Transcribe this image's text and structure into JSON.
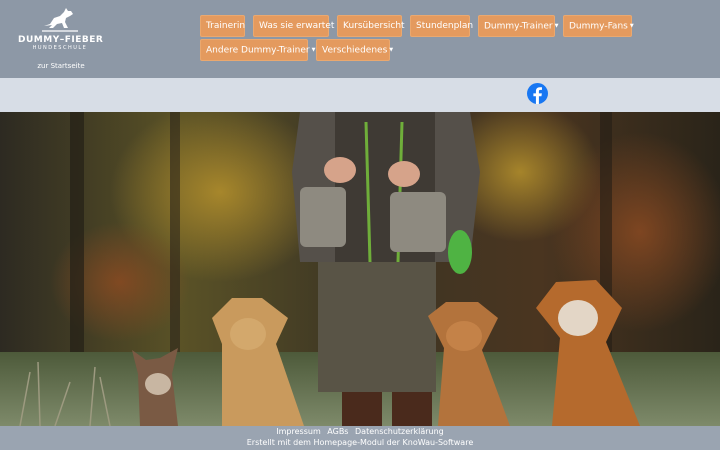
{
  "brand": {
    "name": "DUMMY–FIEBER",
    "tagline": "HUNDESCHULE",
    "home_link": "zur Startseite"
  },
  "nav": {
    "items": [
      {
        "label": "Trainerin",
        "dropdown": false
      },
      {
        "label": "Was sie erwartet",
        "dropdown": false
      },
      {
        "label": "Kursübersicht",
        "dropdown": false
      },
      {
        "label": "Stundenplan",
        "dropdown": false
      },
      {
        "label": "Dummy-Trainer",
        "dropdown": true
      },
      {
        "label": "Dummy-Fans",
        "dropdown": true
      },
      {
        "label": "Andere Dummy-Trainer",
        "dropdown": true
      },
      {
        "label": "Verschiedenes",
        "dropdown": true
      }
    ],
    "caret": "▼"
  },
  "social": {
    "icon": "facebook-icon",
    "color": "#1877f2"
  },
  "footer": {
    "links": [
      "Impressum",
      "AGBs",
      "Datenschutzerklärung"
    ],
    "credit": "Erstellt mit dem Homepage-Modul der KnoWau-Software"
  },
  "colors": {
    "header_bg": "#8d98a6",
    "nav_button": "#e49a5e",
    "social_bar": "#d7dde6",
    "footer_bg": "#9aa4b1"
  }
}
